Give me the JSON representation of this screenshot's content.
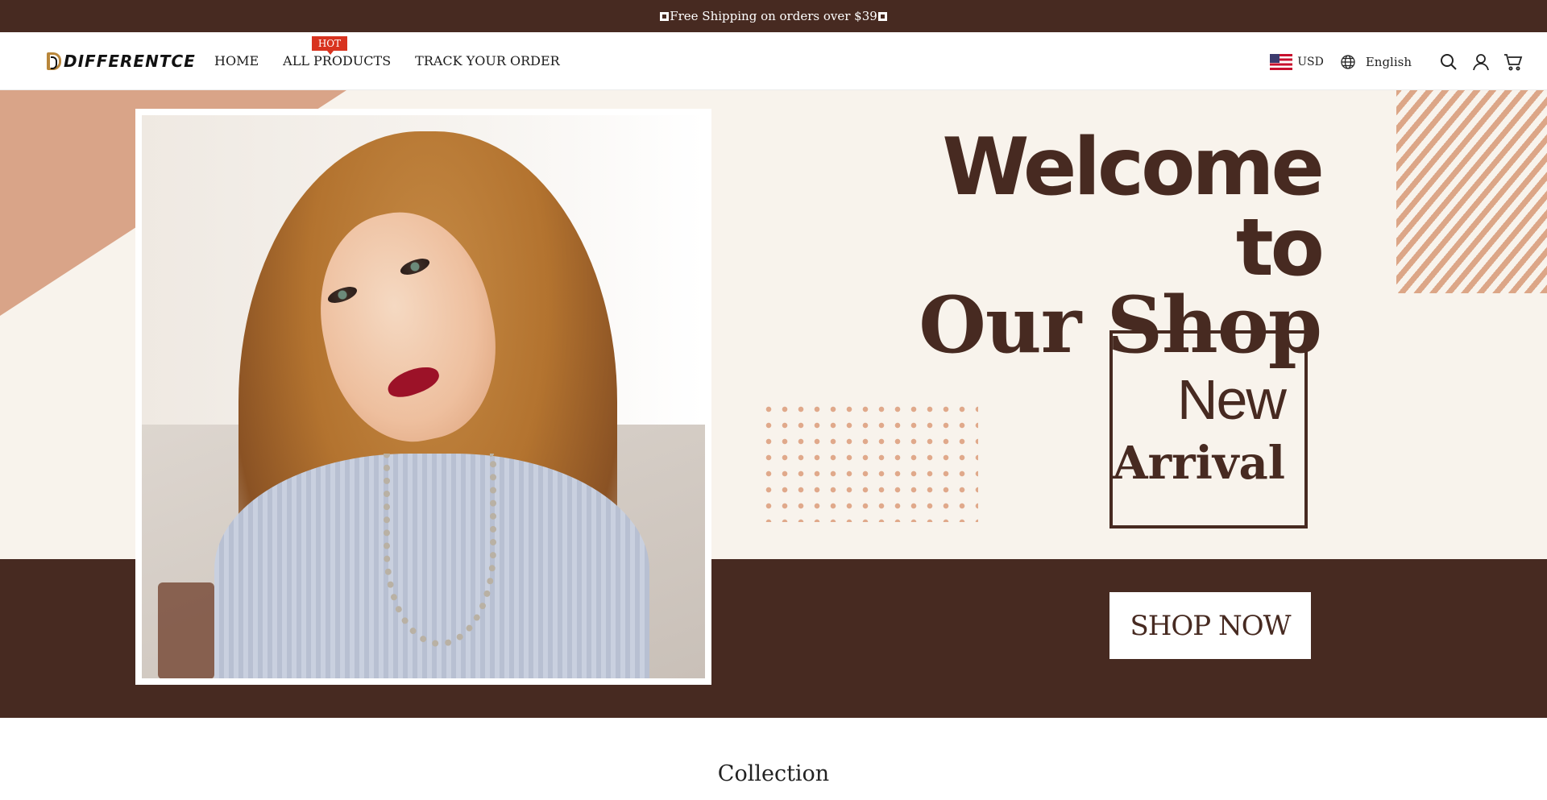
{
  "announcement": {
    "text": "Free Shipping on orders over $39"
  },
  "header": {
    "logo_text": "DIFFERENTCE",
    "nav": [
      {
        "label": "HOME"
      },
      {
        "label": "ALL PRODUCTS",
        "badge": "HOT"
      },
      {
        "label": "TRACK YOUR ORDER"
      }
    ],
    "currency": "USD",
    "language": "English",
    "icons": [
      "us-flag-icon",
      "globe-icon",
      "search-icon",
      "account-icon",
      "cart-icon"
    ]
  },
  "hero": {
    "headline_line1": "Welcome to",
    "headline_line2": "Our Shop",
    "arrival_line1": "New",
    "arrival_line2": "Arrival",
    "cta_label": "SHOP NOW"
  },
  "collection": {
    "title": "Collection"
  },
  "colors": {
    "brand_dark": "#472a21",
    "accent_peach": "#d9a488",
    "hot_badge": "#d8331f",
    "hero_bg": "#f8f3ec"
  }
}
